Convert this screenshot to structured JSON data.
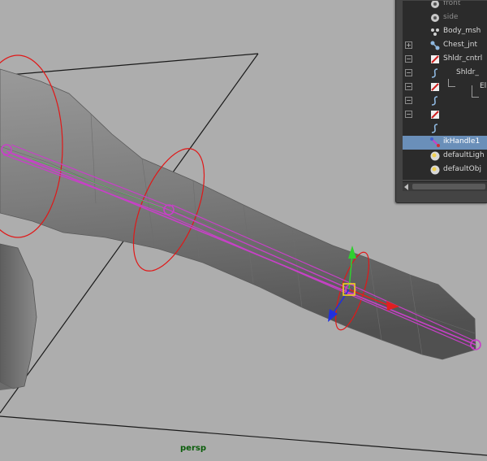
{
  "viewport": {
    "camera_label": "persp"
  },
  "outliner": {
    "items": [
      {
        "label": "front",
        "icon": "camera-icon",
        "expander": ""
      },
      {
        "label": "side",
        "icon": "camera-icon",
        "expander": ""
      },
      {
        "label": "Body_msh",
        "icon": "mesh-icon",
        "expander": ""
      },
      {
        "label": "Chest_jnt",
        "icon": "joint-icon",
        "expander": "+"
      },
      {
        "label": "Shldr_cntrl",
        "icon": "nurbs-curve-icon",
        "expander": "−"
      },
      {
        "label": "Shldr_",
        "icon": "curve-shape-icon",
        "expander": "−"
      },
      {
        "label": "Elb",
        "icon": "nurbs-curve-icon",
        "expander": "−"
      },
      {
        "label": "",
        "icon": "curve-shape-icon",
        "expander": "−"
      },
      {
        "label": "",
        "icon": "nurbs-curve-icon",
        "expander": "−"
      },
      {
        "label": "",
        "icon": "curve-shape-icon",
        "expander": ""
      },
      {
        "label": "ikHandle1",
        "icon": "ik-handle-icon",
        "expander": "",
        "selected": true
      },
      {
        "label": "defaultLigh",
        "icon": "light-set-icon",
        "expander": ""
      },
      {
        "label": "defaultObj",
        "icon": "object-set-icon",
        "expander": ""
      }
    ]
  },
  "colors": {
    "viewport_bg": "#adadad",
    "grid_line": "#1a1a1a",
    "joint_chain": "#c840c8",
    "control_circle": "#e01818",
    "selection_highlight": "#6a8fb9",
    "camera_label": "#0a5d0a"
  }
}
